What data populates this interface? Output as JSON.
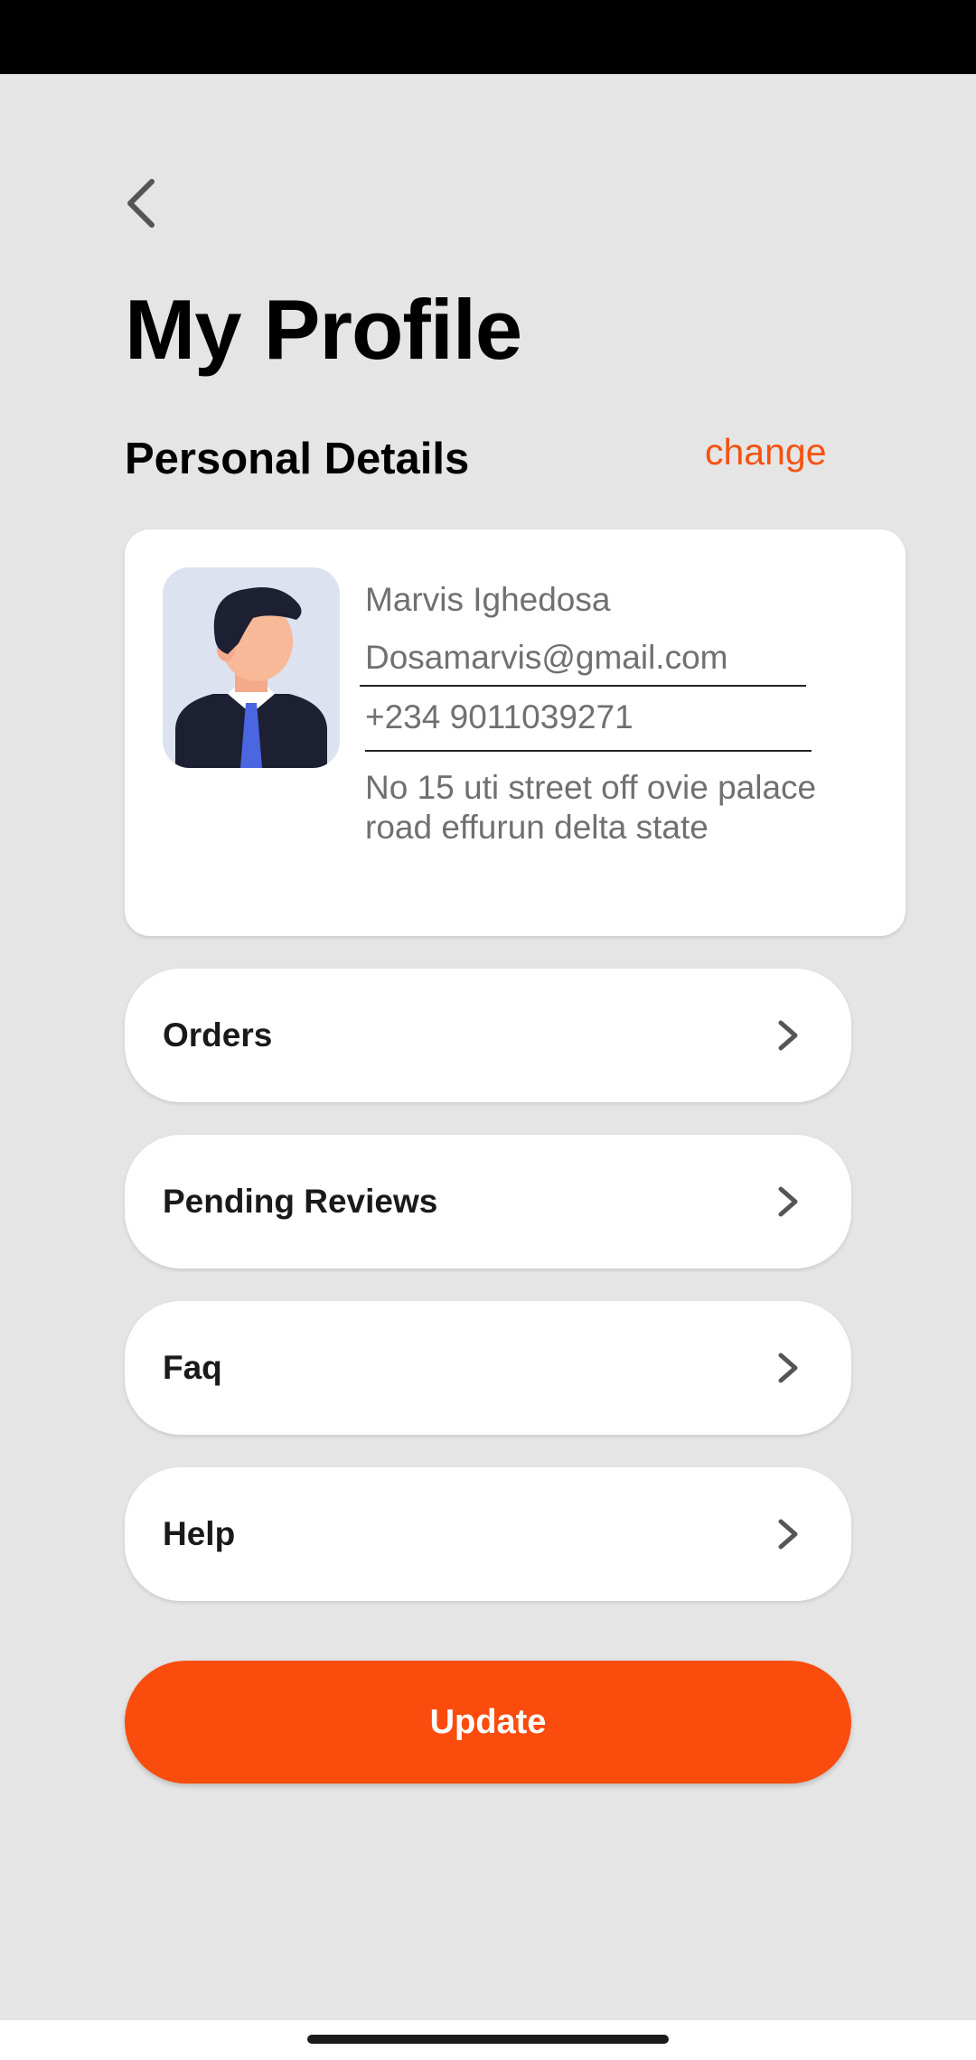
{
  "header": {
    "title": "My Profile"
  },
  "personal_details": {
    "section_title": "Personal Details",
    "change_label": "change",
    "name": "Marvis Ighedosa",
    "email": "Dosamarvis@gmail.com",
    "phone": "+234 9011039271",
    "address": "No 15 uti street off ovie palace road effurun delta state"
  },
  "menu": {
    "items": [
      {
        "label": "Orders"
      },
      {
        "label": "Pending Reviews"
      },
      {
        "label": "Faq"
      },
      {
        "label": "Help"
      }
    ]
  },
  "actions": {
    "update_label": "Update"
  },
  "colors": {
    "accent": "#f94c0d",
    "link": "#f55211",
    "background": "#e5e5e5"
  },
  "icons": {
    "back": "chevron-left-icon",
    "menu_arrow": "chevron-right-icon",
    "avatar": "user-avatar-illustration"
  }
}
